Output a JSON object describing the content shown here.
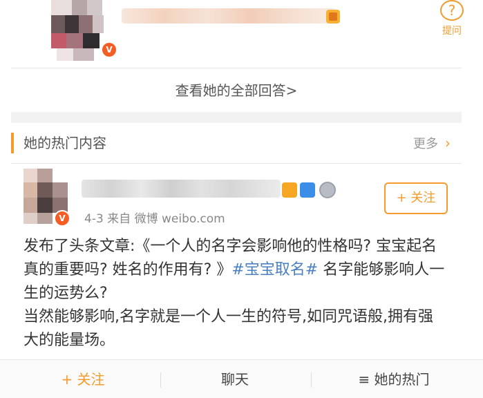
{
  "top_card": {
    "question_icon": "question-mark-icon",
    "question_label": "提问"
  },
  "view_all_answers": "查看她的全部回答>",
  "hot_section": {
    "title": "她的热门内容",
    "more_label": "更多",
    "more_icon": "chevron-right-icon"
  },
  "post": {
    "meta": "4-3  来自 微博 weibo.com",
    "follow_label": "+ 关注",
    "text_prefix": "发布了头条文章:《一个人的名字会影响他的性格吗? 宝宝起名真的重要吗? 姓名的作用有? 》",
    "hashtag": "#宝宝取名#",
    "text_after_hashtag": " 名字能够影响人一生的运势么?",
    "paragraph2": "当然能够影响,名字就是一个人一生的符号,如同咒语般,拥有强大的能量场。"
  },
  "bottom_tabs": {
    "follow": "+ 关注",
    "chat": "聊天",
    "hot": "≡ 她的热门"
  },
  "colors": {
    "accent": "#f59a2c",
    "hashtag": "#4a7fc1",
    "verified_badge": "#f45d24"
  }
}
